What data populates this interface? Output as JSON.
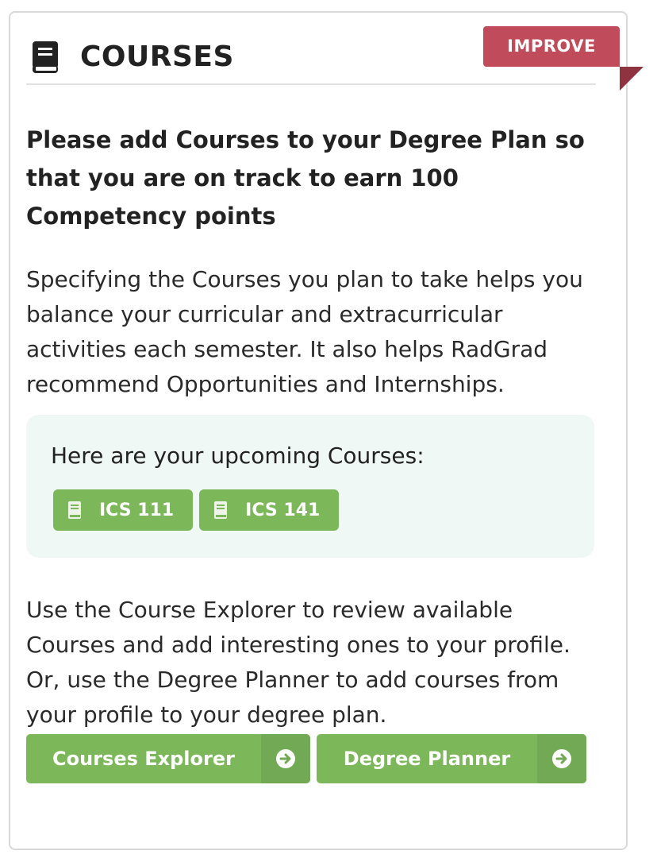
{
  "card": {
    "title": "COURSES",
    "title_icon": "book-icon",
    "ribbon_label": "IMPROVE",
    "headline": "Please add Courses to your Degree Plan so that you are on track to earn 100 Competency points",
    "description": "Specifying the Courses you plan to take helps you balance your curricular and extracurricular activities each semester. It also helps RadGrad recommend Opportunities and Internships.",
    "upcoming": {
      "label": "Here are your upcoming Courses:",
      "courses": [
        {
          "label": "ICS 111",
          "icon": "book-icon"
        },
        {
          "label": "ICS 141",
          "icon": "book-icon"
        }
      ]
    },
    "instructions": "Use the Course Explorer to review available Courses and add interesting ones to your profile. Or, use the Degree Planner to add courses from your profile to your degree plan.",
    "buttons": [
      {
        "label": "Courses Explorer",
        "icon": "arrow-circle-right-icon"
      },
      {
        "label": "Degree Planner",
        "icon": "arrow-circle-right-icon"
      }
    ]
  },
  "colors": {
    "accent_green": "#7cb85a",
    "ribbon_red": "#c04b5a",
    "panel_bg": "#eff8f5"
  }
}
